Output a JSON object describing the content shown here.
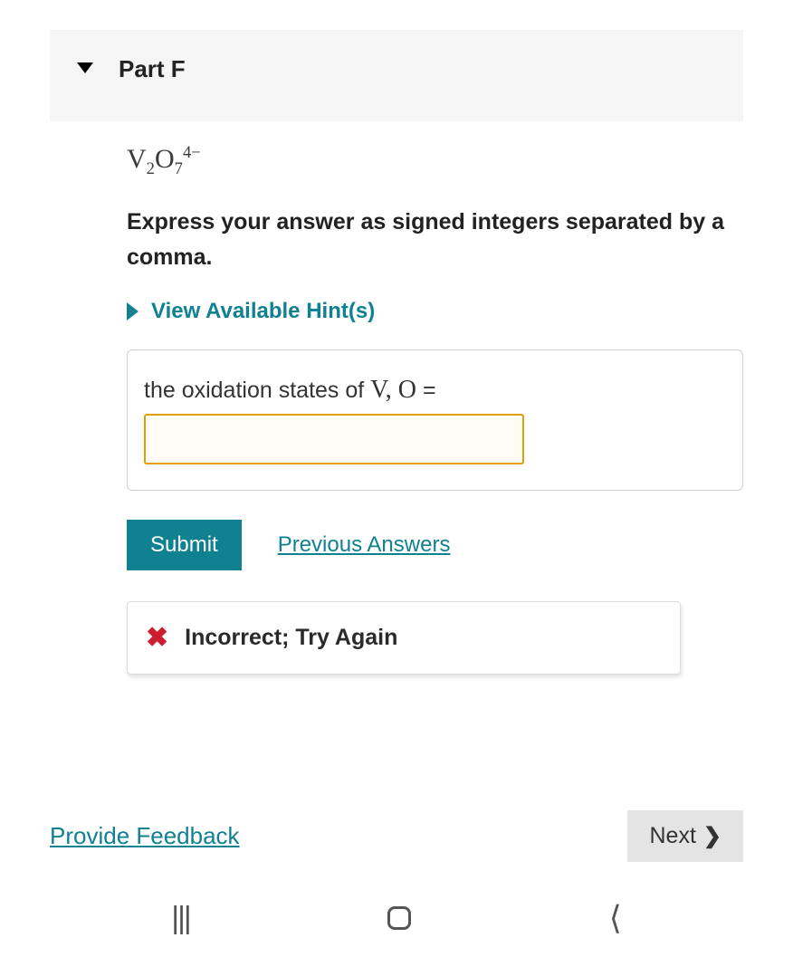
{
  "part": {
    "title": "Part F"
  },
  "question": {
    "formula_html": "V<sub>2</sub>O<sub>7</sub><sup>4&minus;</sup>",
    "instruction": "Express your answer as signed integers separated by a comma."
  },
  "hints": {
    "link_label": "View Available Hint(s)"
  },
  "answer": {
    "label_prefix": "the oxidation states of ",
    "label_vars": "V, O",
    "label_suffix": " =",
    "value": ""
  },
  "buttons": {
    "submit": "Submit",
    "previous_answers": "Previous Answers"
  },
  "feedback": {
    "message": "Incorrect; Try Again"
  },
  "footer": {
    "provide_feedback": "Provide Feedback",
    "next": "Next"
  }
}
